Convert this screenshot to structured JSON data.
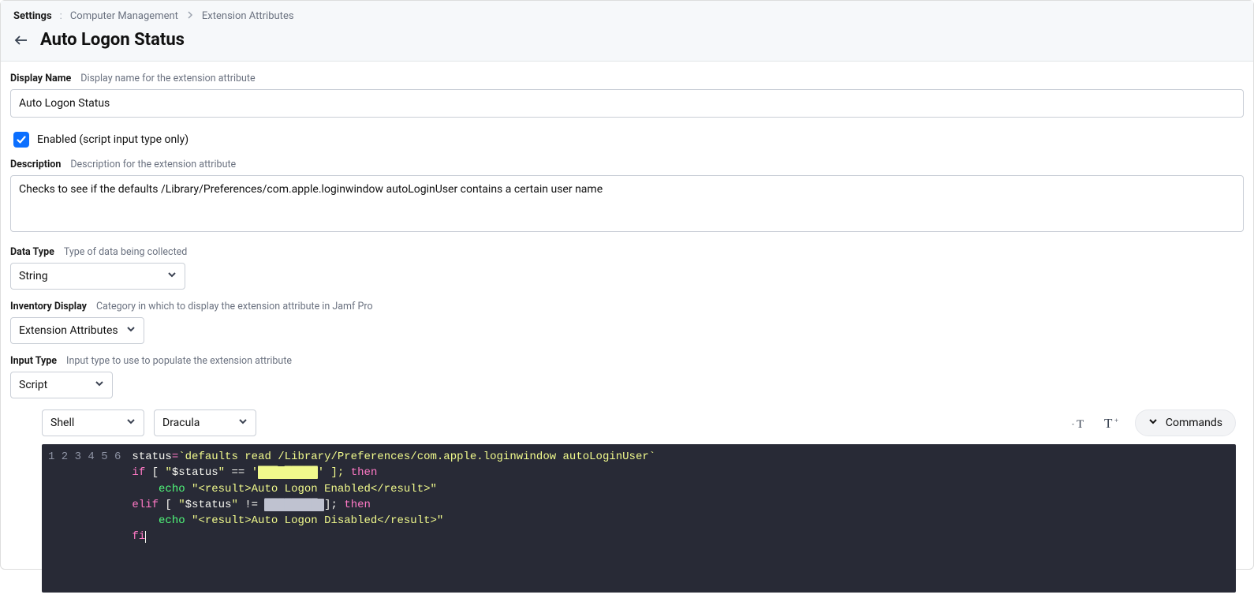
{
  "breadcrumb": {
    "root": "Settings",
    "sep1": ":",
    "level1": "Computer Management",
    "level2": "Extension Attributes"
  },
  "title": "Auto Logon Status",
  "fields": {
    "display_name": {
      "label": "Display Name",
      "hint": "Display name for the extension attribute",
      "value": "Auto Logon Status"
    },
    "enabled": {
      "checked": true,
      "label": "Enabled (script input type only)"
    },
    "description": {
      "label": "Description",
      "hint": "Description for the extension attribute",
      "value": "Checks to see if the defaults /Library/Preferences/com.apple.loginwindow autoLoginUser contains a certain user name"
    },
    "data_type": {
      "label": "Data Type",
      "hint": "Type of data being collected",
      "value": "String"
    },
    "inventory_display": {
      "label": "Inventory Display",
      "hint": "Category in which to display the extension attribute in Jamf Pro",
      "value": "Extension Attributes"
    },
    "input_type": {
      "label": "Input Type",
      "hint": "Input type to use to populate the extension attribute",
      "value": "Script"
    }
  },
  "script": {
    "language": "Shell",
    "theme": "Dracula",
    "commands_label": "Commands",
    "gutter": "1\n2\n3\n4\n5\n6",
    "line1": {
      "a": "status",
      "b": "=",
      "c": "`defaults read /Library/Preferences/com.apple.loginwindow autoLoginUser`"
    },
    "line2": {
      "kw1": "if",
      "open": " [ ",
      "q1": "\"",
      "var": "$status",
      "q2": "\"",
      "op": " == ",
      "q3": "'",
      "red1": "███ █████",
      "q4": "' ]; ",
      "kw2": "then"
    },
    "line3": {
      "indent": "    ",
      "cmd": "echo",
      "sp": " ",
      "str": "\"<result>Auto Logon Enabled</result>\""
    },
    "line4": {
      "kw1": "elif",
      "open": " [ ",
      "q1": "\"",
      "var": "$status",
      "q2": "\"",
      "op": " != ",
      "red2": "████████ ",
      "close": "]; ",
      "kw2": "then"
    },
    "line5": {
      "indent": "    ",
      "cmd": "echo",
      "sp": " ",
      "str": "\"<result>Auto Logon Disabled</result>\""
    },
    "line6": {
      "kw": "fi"
    }
  }
}
